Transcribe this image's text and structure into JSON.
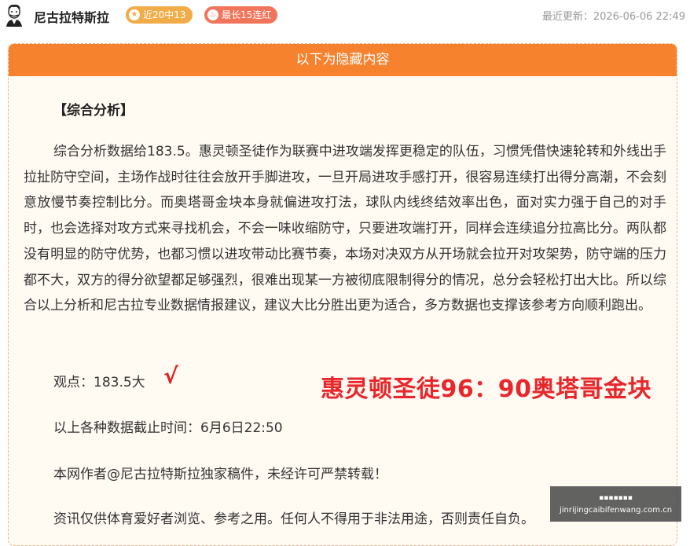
{
  "header": {
    "author": "尼古拉特斯拉",
    "badge_recent": "近20中13",
    "badge_streak": "最长15连红",
    "updated_label": "最近更新：2026-06-06 22:49"
  },
  "hidden": {
    "title": "以下为隐藏内容"
  },
  "content": {
    "section_title": "【综合分析】",
    "analysis": "综合分析数据给183.5。惠灵顿圣徒作为联赛中进攻端发挥更稳定的队伍，习惯凭借快速轮转和外线出手拉扯防守空间，主场作战时往往会放开手脚进攻，一旦开局进攻手感打开，很容易连续打出得分高潮，不会刻意放慢节奏控制比分。而奥塔哥金块本身就偏进攻打法，球队内线终结效率出色，面对实力强于自己的对手时，也会选择对攻方式来寻找机会，不会一味收缩防守，只要进攻端打开，同样会连续追分拉高比分。两队都没有明显的防守优势，也都习惯以进攻带动比赛节奏，本场对决双方从开场就会拉开对攻架势，防守端的压力都不大，双方的得分欲望都足够强烈，很难出现某一方被彻底限制得分的情况，总分会轻松打出大比。所以综合以上分析和尼古拉专业数据情报建议，建议大比分胜出更为适合，多方数据也支撑该参考方向顺利跑出。",
    "opinion": "观点：183.5大",
    "check_mark": "√",
    "score": "惠灵顿圣徒96：90奥塔哥金块",
    "cutoff": "以上各种数据截止时间：6月6日22:50",
    "copyright": "本网作者@尼古拉特斯拉独家稿件，未经许可严禁转载！",
    "disclaimer": "资讯仅供体育爱好者浏览、参考之用。任何人不得用于非法用途，否则责任自负。"
  },
  "watermark": {
    "top": "▪▪▪▪▪▪▪",
    "site": "jinrijingcaibifenwang.com.cn"
  },
  "colors": {
    "hidden_header": "#f7822e",
    "score_red": "#e8262b",
    "badge_orange": "#f2ac47",
    "badge_red": "#f2745a"
  }
}
